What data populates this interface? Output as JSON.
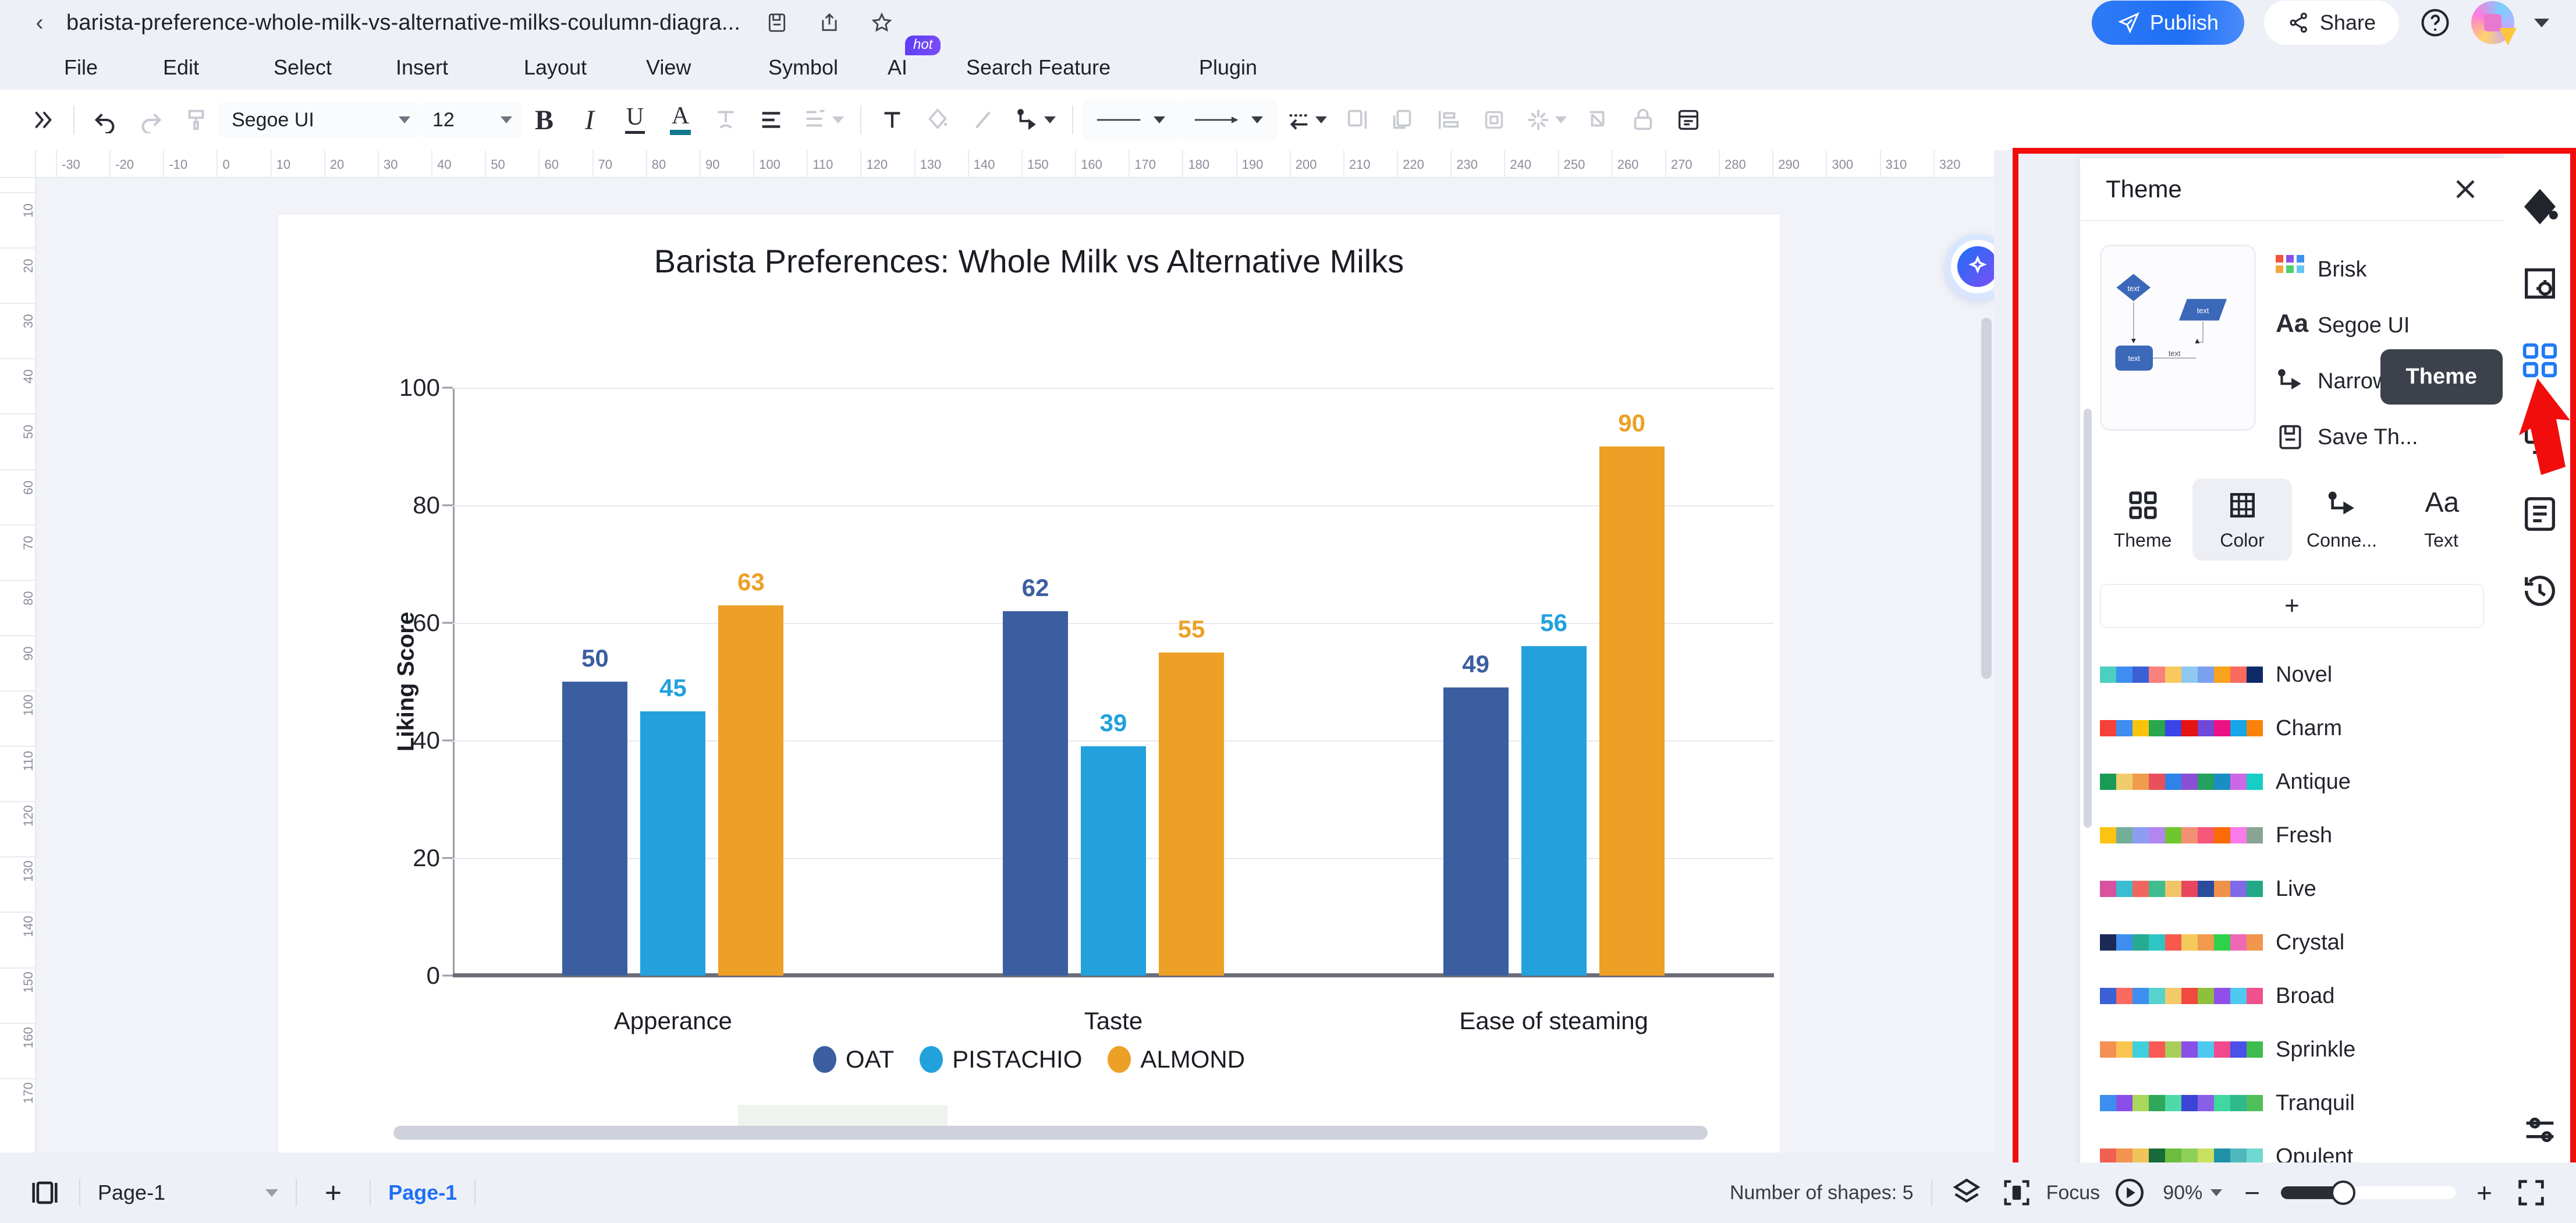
{
  "titlebar": {
    "document_title": "barista-preference-whole-milk-vs-alternative-milks-coulumn-diagra...",
    "back_icon": "chevron-left-icon",
    "save_icon": "save-icon",
    "export_icon": "export-icon",
    "favorite_icon": "star-icon",
    "publish_label": "Publish",
    "share_label": "Share",
    "help_icon": "help-circle-icon",
    "avatar_icon": "user-avatar",
    "account_caret": "chevron-down-icon"
  },
  "menubar": {
    "items": [
      {
        "label": "File"
      },
      {
        "label": "Edit"
      },
      {
        "label": "Select"
      },
      {
        "label": "Insert"
      },
      {
        "label": "Layout"
      },
      {
        "label": "View"
      },
      {
        "label": "Symbol"
      },
      {
        "label": "AI",
        "badge": "hot"
      },
      {
        "label": "Search Feature"
      },
      {
        "label": "Plugin"
      }
    ]
  },
  "toolbar": {
    "expand_icon": "chevron-double-right-icon",
    "undo_icon": "undo-icon",
    "redo_icon": "redo-icon",
    "format_painter_icon": "format-painter-icon",
    "font_family": "Segoe UI",
    "font_size": "12",
    "bold_label": "B",
    "italic_label": "I",
    "underline_label": "U",
    "font_color_label": "A",
    "font_color_swatch": "#12788f",
    "text_shape_icon": "text-shape-icon",
    "align_icon": "align-left-icon",
    "list_icon": "list-icon",
    "insert_text_icon": "text-box-icon",
    "fill_icon": "fill-color-icon",
    "line_icon": "line-color-icon",
    "connector_icon": "connector-icon",
    "line_style_icon": "line-style-icon",
    "arrow_style_icon": "arrow-style-icon",
    "line_jump_icon": "line-jump-icon",
    "group_icon": "group-icon",
    "duplicate_icon": "duplicate-icon",
    "align_objects_icon": "align-objects-icon",
    "distribute_icon": "distribute-icon",
    "effects_icon": "effects-icon",
    "crop_icon": "crop-icon",
    "lock_icon": "lock-icon",
    "reset_icon": "reset-icon"
  },
  "rulers": {
    "horizontal": [
      "-30",
      "-20",
      "-10",
      "0",
      "10",
      "20",
      "30",
      "40",
      "50",
      "60",
      "70",
      "80",
      "90",
      "100",
      "110",
      "120",
      "130",
      "140",
      "150",
      "160",
      "170",
      "180",
      "190",
      "200",
      "210",
      "220",
      "230",
      "240",
      "250",
      "260",
      "270",
      "280",
      "290",
      "300",
      "310",
      "320"
    ],
    "vertical": [
      "10",
      "20",
      "30",
      "40",
      "50",
      "60",
      "70",
      "80",
      "90",
      "100",
      "110",
      "120",
      "130",
      "140",
      "150",
      "160",
      "170"
    ]
  },
  "canvas": {
    "ai_assistant_icon": "ai-sparkle-icon",
    "vertical_scrollbar": "vertical-scrollbar",
    "horizontal_scrollbar": "horizontal-scrollbar"
  },
  "chart_data": {
    "type": "bar",
    "title": "Barista Preferences: Whole Milk vs Alternative Milks",
    "xlabel": "",
    "ylabel": "Liking Score",
    "categories": [
      "Apperance",
      "Taste",
      "Ease of steaming"
    ],
    "ylim": [
      0,
      100
    ],
    "yticks": [
      0,
      20,
      40,
      60,
      80,
      100
    ],
    "grid": true,
    "legend_position": "bottom",
    "series": [
      {
        "name": "OAT",
        "color": "#3b5ea0",
        "values": [
          50,
          62,
          49
        ]
      },
      {
        "name": "PISTACHIO",
        "color": "#22a1dd",
        "values": [
          45,
          39,
          56
        ]
      },
      {
        "name": "ALMOND",
        "color": "#eda026",
        "values": [
          63,
          55,
          90
        ]
      }
    ]
  },
  "right_panel": {
    "title": "Theme",
    "close_icon": "close-icon",
    "preview_icon": "theme-preview-diagram",
    "properties": [
      {
        "icon": "brisk-grid-icon",
        "label": "Brisk"
      },
      {
        "icon": "font-aa-icon",
        "label": "Segoe UI"
      },
      {
        "icon": "connector-icon",
        "label": "Narrow"
      },
      {
        "icon": "save-icon",
        "label": "Save Th..."
      }
    ],
    "tabs": [
      {
        "icon": "theme-grid-icon",
        "label": "Theme",
        "active": false
      },
      {
        "icon": "color-table-icon",
        "label": "Color",
        "active": true
      },
      {
        "icon": "connector-icon",
        "label": "Conne...",
        "active": false
      },
      {
        "icon": "text-aa-icon",
        "label": "Text",
        "active": false
      }
    ],
    "add_label": "+",
    "palettes": [
      {
        "name": "Novel",
        "colors": [
          "#4ccfc0",
          "#3d8ef0",
          "#3b5fd4",
          "#f9807c",
          "#fac95e",
          "#8fc9f2",
          "#7ba0ee",
          "#f9a21b",
          "#f96a5f",
          "#0e2a66"
        ]
      },
      {
        "name": "Charm",
        "colors": [
          "#f6403a",
          "#3d8ef0",
          "#fbc40c",
          "#2aa64e",
          "#3b44e8",
          "#e61313",
          "#7148d8",
          "#ec1283",
          "#17a6e8",
          "#f98309"
        ]
      },
      {
        "name": "Antique",
        "colors": [
          "#199a57",
          "#f0cd6a",
          "#ef9c4f",
          "#e8505b",
          "#2f82e8",
          "#8a4fd4",
          "#24a05f",
          "#1a8ec2",
          "#cc68e8",
          "#16cec3"
        ]
      },
      {
        "name": "Fresh",
        "colors": [
          "#fcc312",
          "#74ae9a",
          "#8d9ef2",
          "#b485ef",
          "#6fc62f",
          "#f58f74",
          "#f5587a",
          "#fa6a07",
          "#f97ae8",
          "#8aa493"
        ]
      },
      {
        "name": "Live",
        "colors": [
          "#d8529f",
          "#3bbdd1",
          "#f0665e",
          "#3ebd8e",
          "#f2c469",
          "#e8455f",
          "#2b4b9c",
          "#f0914a",
          "#7f6ae8",
          "#23a887"
        ]
      },
      {
        "name": "Crystal",
        "colors": [
          "#1c2a56",
          "#3d8ef0",
          "#27aa92",
          "#2ec6c3",
          "#f9584f",
          "#f5c95a",
          "#f09a4f",
          "#2fd04a",
          "#f068b4",
          "#f0964f"
        ]
      },
      {
        "name": "Broad",
        "colors": [
          "#3b5fd4",
          "#f96a5f",
          "#3d8ef0",
          "#56d3cc",
          "#f4c96a",
          "#f04a3f",
          "#8fbf3c",
          "#8f4fe8",
          "#4fc8f0",
          "#f0508e"
        ]
      },
      {
        "name": "Sprinkle",
        "colors": [
          "#f59053",
          "#f9c44f",
          "#3fd0dd",
          "#f95a54",
          "#a9cf5a",
          "#8a4fe8",
          "#4fc8f0",
          "#f04a8c",
          "#4a50e8",
          "#3fbc4f"
        ]
      },
      {
        "name": "Tranquil",
        "colors": [
          "#3d8ef0",
          "#8a4fe8",
          "#a9d85a",
          "#2fa85a",
          "#4fd8a8",
          "#3b44d4",
          "#8a5fe8",
          "#3fd8a0",
          "#2fb88a",
          "#4fc05a"
        ]
      },
      {
        "name": "Opulent",
        "colors": [
          "#f06050",
          "#f09450",
          "#f0c45a",
          "#176b3a",
          "#6bbc3f",
          "#8fd05a",
          "#c9e060",
          "#1f91a8",
          "#4fb8bc",
          "#6fd8d0"
        ]
      }
    ]
  },
  "rail": {
    "items": [
      {
        "icon": "fill-bucket-icon",
        "label": "Fill",
        "active": false
      },
      {
        "icon": "page-settings-icon",
        "label": "Page Settings",
        "active": false
      },
      {
        "icon": "theme-grid-icon",
        "label": "Theme",
        "active": true
      },
      {
        "icon": "present-icon",
        "label": "Presentation",
        "active": false
      },
      {
        "icon": "notes-icon",
        "label": "Notes",
        "active": false
      },
      {
        "icon": "history-icon",
        "label": "History",
        "active": false
      }
    ],
    "bottom_icon": "settings-sliders-icon",
    "tooltip": "Theme"
  },
  "statusbar": {
    "page_view_icon": "page-view-icon",
    "page_select": "Page-1",
    "page_select_caret": "chevron-down-icon",
    "add_page_label": "+",
    "active_page_tab": "Page-1",
    "shapes_count": "Number of shapes: 5",
    "layers_icon": "layers-icon",
    "focus_icon": "focus-icon",
    "focus_label": "Focus",
    "play_icon": "play-circle-icon",
    "zoom_level": "90%",
    "zoom_caret": "chevron-down-icon",
    "zoom_out_label": "−",
    "zoom_in_label": "+",
    "fullscreen_icon": "fullscreen-icon"
  }
}
